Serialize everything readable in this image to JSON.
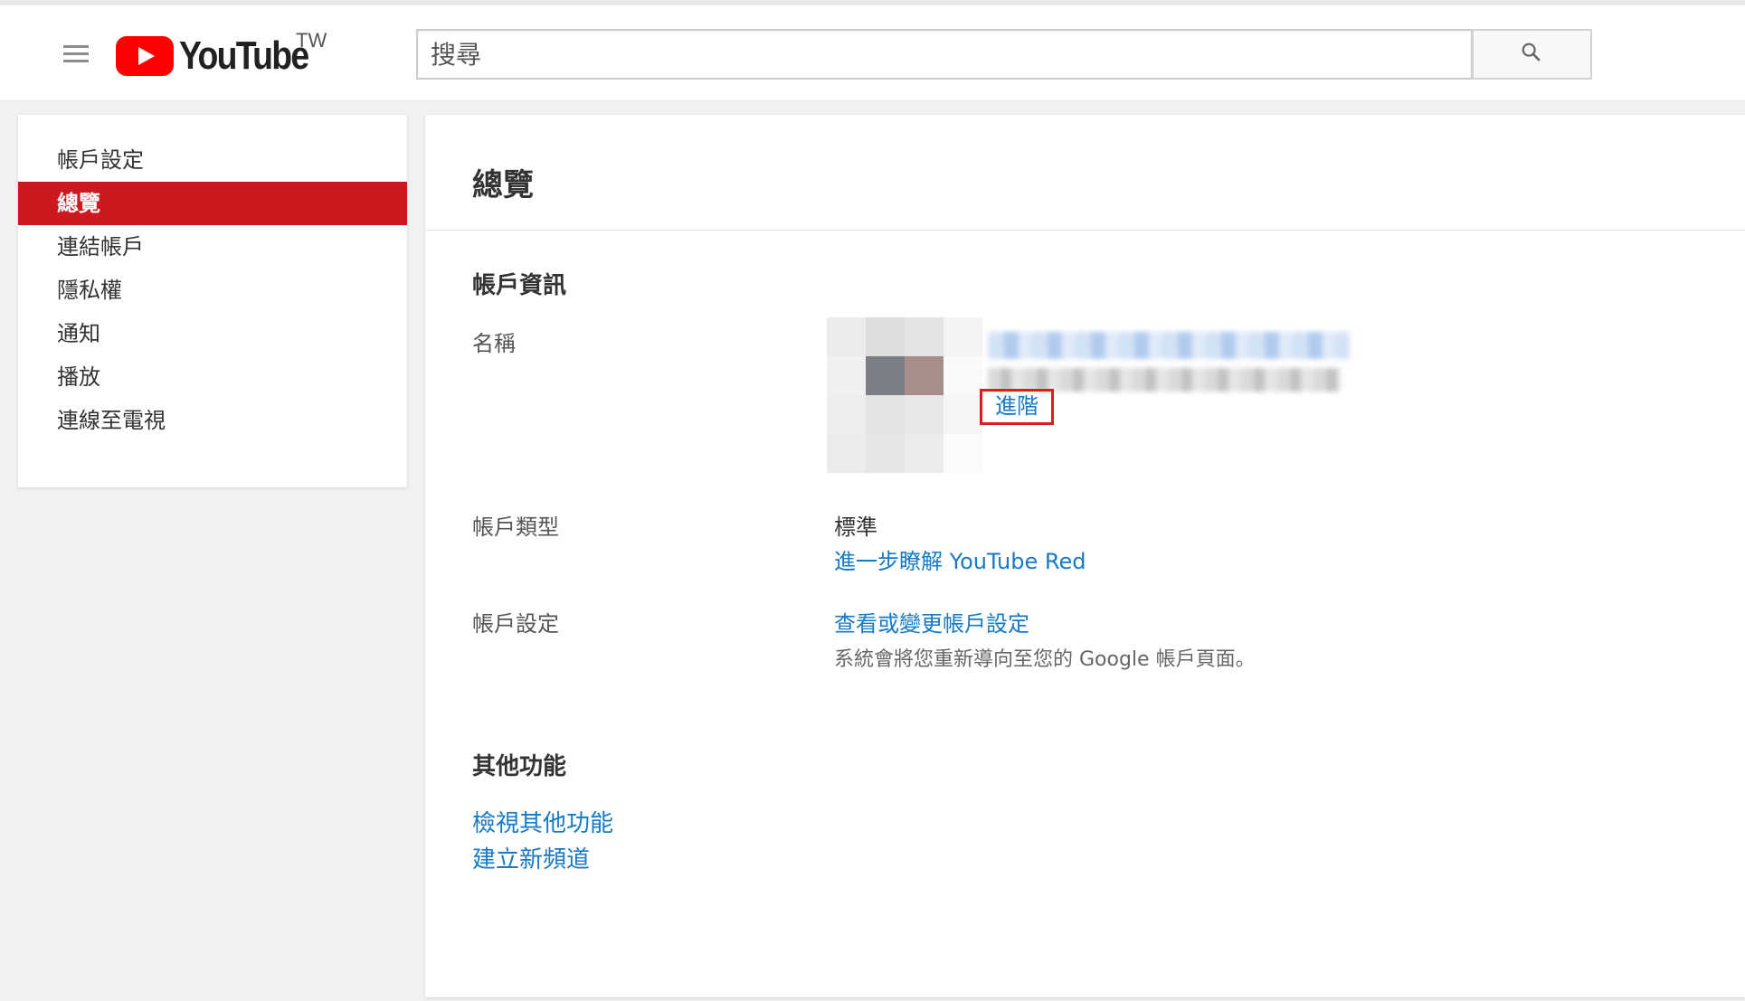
{
  "header": {
    "logo_text": "YouTube",
    "region": "TW",
    "search_placeholder": "搜尋"
  },
  "sidebar": {
    "items": [
      {
        "label": "帳戶設定"
      },
      {
        "label": "總覽"
      },
      {
        "label": "連結帳戶"
      },
      {
        "label": "隱私權"
      },
      {
        "label": "通知"
      },
      {
        "label": "播放"
      },
      {
        "label": "連線至電視"
      }
    ],
    "active_index": 1
  },
  "main": {
    "title": "總覽",
    "account_info": {
      "heading": "帳戶資訊",
      "name_label": "名稱",
      "advanced_link": "進階",
      "type_label": "帳戶類型",
      "type_value": "標準",
      "red_link": "進一步瞭解 YouTube Red",
      "settings_label": "帳戶設定",
      "settings_link": "查看或變更帳戶設定",
      "settings_note": "系統會將您重新導向至您的 Google 帳戶頁面。"
    },
    "other": {
      "heading": "其他功能",
      "view_link": "檢視其他功能",
      "create_link": "建立新頻道"
    }
  },
  "colors": {
    "brand_red": "#ff0000",
    "active_bg": "#cc181e",
    "link": "#167ac6",
    "highlight_box": "#e01b1b"
  }
}
